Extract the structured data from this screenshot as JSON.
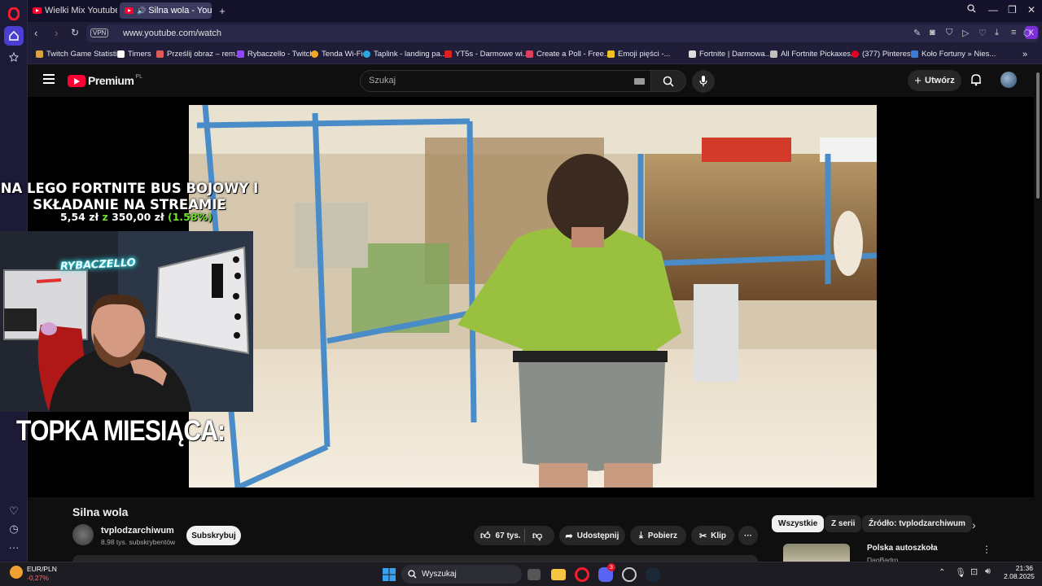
{
  "browser": {
    "tabs": [
      {
        "label": "Wielki Mix Youtube by Sc"
      },
      {
        "label": "Silna wola - YouTube"
      }
    ],
    "url": "www.youtube.com/watch",
    "vpn_label": "VPN",
    "profile_initial": "K",
    "bookmarks": [
      {
        "label": "Twitch Game Statisti...",
        "color": "#d9a441"
      },
      {
        "label": "Timers",
        "color": "#ffffff"
      },
      {
        "label": "Prześlij obraz – rem...",
        "color": "#e05a5a"
      },
      {
        "label": "Rybaczello - Twitch",
        "color": "#9146ff"
      },
      {
        "label": "Tenda Wi-Fi",
        "color": "#f5a623"
      },
      {
        "label": "Taplink - landing pa...",
        "color": "#2aa8e0"
      },
      {
        "label": "YT5s - Darmowe wi...",
        "color": "#e02020"
      },
      {
        "label": "Create a Poll - Free...",
        "color": "#e04060"
      },
      {
        "label": "Emoji pięści -...",
        "color": "#f0c020"
      },
      {
        "label": "Fortnite | Darmowa...",
        "color": "#dddddd"
      },
      {
        "label": "All Fortnite Pickaxes...",
        "color": "#c0c0c0"
      },
      {
        "label": "(377) Pinterest",
        "color": "#e60023"
      },
      {
        "label": "Koło Fortuny » Nies...",
        "color": "#3a7bd5"
      }
    ]
  },
  "youtube": {
    "logo_text": "Premium",
    "logo_region": "PL",
    "search_placeholder": "Szukaj",
    "create_label": "Utwórz",
    "video": {
      "title": "Silna wola",
      "channel": "tvplodzarchiwum",
      "subscribers": "8,98 tys. subskrybentów",
      "subscribe_label": "Subskrybuj",
      "likes": "67 tys.",
      "share_label": "Udostępnij",
      "download_label": "Pobierz",
      "clip_label": "Klip"
    },
    "chips": [
      "Wszystkie",
      "Z serii",
      "Źródło: tvplodzarchiwum"
    ],
    "related": [
      {
        "title": "Polska autoszkoła",
        "channel": "DaoBadro"
      }
    ]
  },
  "overlay": {
    "goal_line1": "NA LEGO FORTNITE BUS BOJOWY I",
    "goal_line2": "SKŁADANIE NA STREAMIE",
    "goal_current": "5,54 zł",
    "goal_of": "z",
    "goal_target": "350,00 zł",
    "goal_percent": "(1.58%)",
    "goal_progress": 0.0158,
    "neon_sign": "RYBACZELLO",
    "topka_label": "TOPKA MIESIĄCA:"
  },
  "taskbar": {
    "widget_label": "EUR/PLN",
    "widget_value": "-0,27%",
    "search_label": "Wyszukaj",
    "time": "21:36",
    "date": "2.08.2025",
    "discord_badge": "3"
  },
  "colors": {
    "youtube_red": "#ff0033",
    "opera_red": "#ff1b2d",
    "goal_green": "#6fe12a",
    "sidebar_bg": "#1c1a36"
  }
}
